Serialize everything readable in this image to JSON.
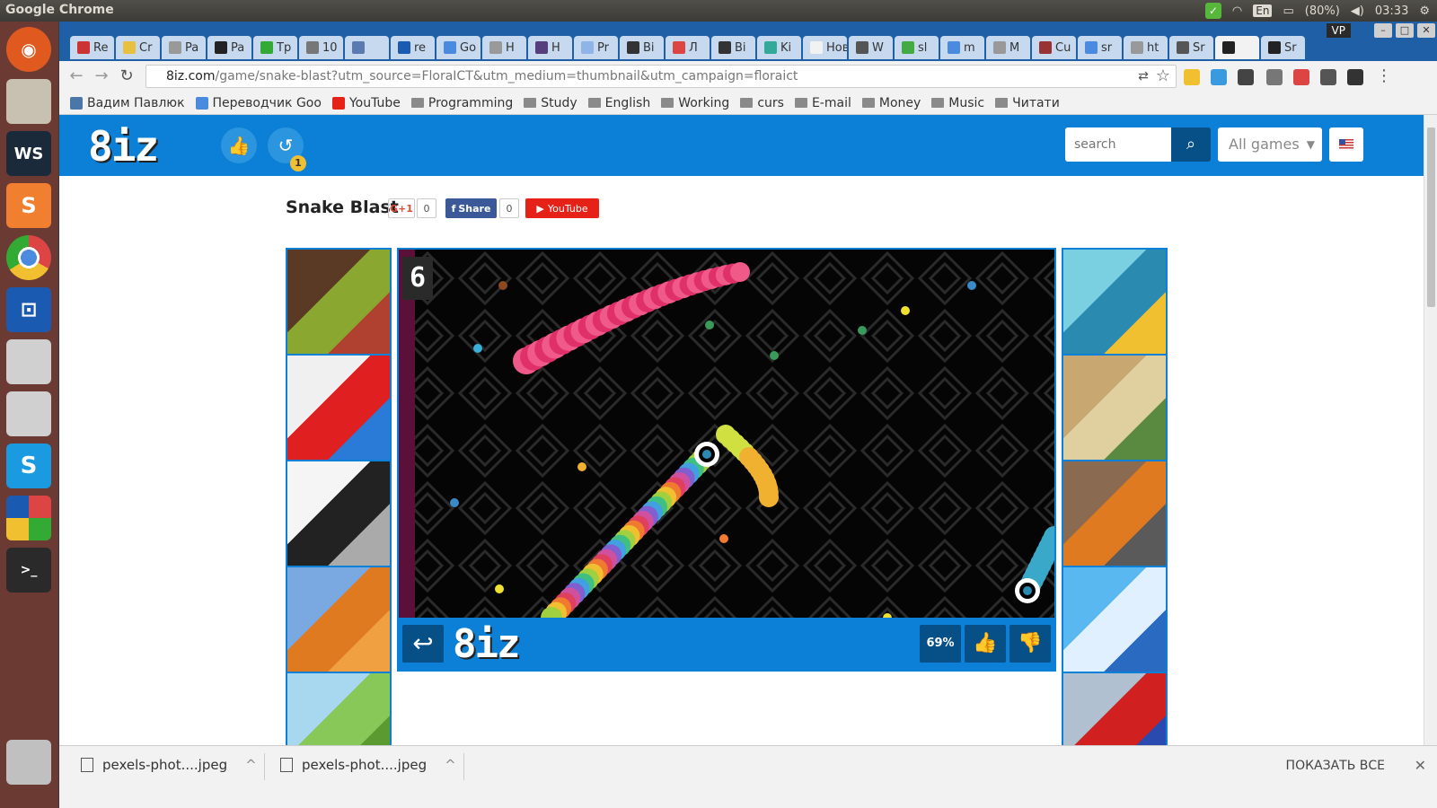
{
  "system": {
    "title": "Google Chrome",
    "lang": "En",
    "battery": "(80%)",
    "time": "03:33"
  },
  "window": {
    "profile": "VP",
    "tabs": [
      {
        "label": "Re",
        "color": "#c33"
      },
      {
        "label": "Cr",
        "color": "#e8c040"
      },
      {
        "label": "Pa",
        "color": "#999"
      },
      {
        "label": "Pa",
        "color": "#222"
      },
      {
        "label": "Tp",
        "color": "#3a3"
      },
      {
        "label": "10",
        "color": "#777"
      },
      {
        "label": "",
        "color": "#5a7ab0"
      },
      {
        "label": "re",
        "color": "#1a5ab0"
      },
      {
        "label": "Go",
        "color": "#4a8be0"
      },
      {
        "label": "H",
        "color": "#999"
      },
      {
        "label": "H",
        "color": "#563d7c"
      },
      {
        "label": "Pr",
        "color": "#8fb5e8"
      },
      {
        "label": "Bi",
        "color": "#333"
      },
      {
        "label": "Л",
        "color": "#d44"
      },
      {
        "label": "Bi",
        "color": "#333"
      },
      {
        "label": "Ki",
        "color": "#3a9"
      },
      {
        "label": "Нова",
        "color": "#f2f2f2"
      },
      {
        "label": "W",
        "color": "#555"
      },
      {
        "label": "sl",
        "color": "#4a4"
      },
      {
        "label": "m",
        "color": "#4a8be0"
      },
      {
        "label": "M",
        "color": "#999"
      },
      {
        "label": "Cu",
        "color": "#933"
      },
      {
        "label": "sr",
        "color": "#4a8be0"
      },
      {
        "label": "ht",
        "color": "#999"
      },
      {
        "label": "Sr",
        "color": "#555"
      },
      {
        "label": "",
        "color": "#222"
      },
      {
        "label": "Sr",
        "color": "#222"
      }
    ]
  },
  "address": {
    "host": "8iz.com",
    "path": "/game/snake-blast?utm_source=FloraICT&utm_medium=thumbnail&utm_campaign=floraict"
  },
  "bookmarks": [
    {
      "label": "Вадим Павлюк",
      "type": "fav",
      "color": "#4a76a8"
    },
    {
      "label": "Переводчик Goo",
      "type": "fav",
      "color": "#4a8be0"
    },
    {
      "label": "YouTube",
      "type": "fav",
      "color": "#e62117"
    },
    {
      "label": "Programming",
      "type": "folder"
    },
    {
      "label": "Study",
      "type": "folder"
    },
    {
      "label": "English",
      "type": "folder"
    },
    {
      "label": "Working",
      "type": "folder"
    },
    {
      "label": "curs",
      "type": "folder"
    },
    {
      "label": "E-mail",
      "type": "folder"
    },
    {
      "label": "Money",
      "type": "folder"
    },
    {
      "label": "Music",
      "type": "folder"
    },
    {
      "label": "Читати",
      "type": "folder"
    }
  ],
  "site": {
    "logo": "8iz",
    "history_count": "1",
    "search_placeholder": "search",
    "games_filter": "All games",
    "game_title": "Snake Blast",
    "gplus_label": "G+1",
    "gplus_count": "0",
    "fb_label": "Share",
    "fb_count": "0",
    "yt_label": "YouTube"
  },
  "game": {
    "score": "6",
    "rating": "69%",
    "bar_logo": "8iz"
  },
  "thumbs_left": [
    {
      "colors": [
        "#5a3a24",
        "#8aa830",
        "#b04030"
      ]
    },
    {
      "colors": [
        "#f0f0f0",
        "#e02020",
        "#2a7ad8"
      ]
    },
    {
      "colors": [
        "#f5f5f5",
        "#222222",
        "#aaaaaa"
      ]
    },
    {
      "colors": [
        "#7aa8e0",
        "#e07a20",
        "#f0a040"
      ]
    },
    {
      "colors": [
        "#a8d8f0",
        "#88c858",
        "#5a9a30"
      ]
    }
  ],
  "thumbs_right": [
    {
      "colors": [
        "#7ad0e0",
        "#2a8ab0",
        "#f0c030"
      ]
    },
    {
      "colors": [
        "#c8a870",
        "#e0d0a0",
        "#5a8a40"
      ]
    },
    {
      "colors": [
        "#8a6a50",
        "#e07a20",
        "#5a5a5a"
      ]
    },
    {
      "colors": [
        "#5ab8f0",
        "#e0f0ff",
        "#2a6ac0"
      ]
    },
    {
      "colors": [
        "#b0c0d0",
        "#d02020",
        "#2a4ab0"
      ]
    }
  ],
  "downloads": [
    {
      "name": "pexels-phot....jpeg"
    },
    {
      "name": "pexels-phot....jpeg"
    }
  ],
  "downloads_show_all": "ПОКАЗАТЬ ВСЕ"
}
